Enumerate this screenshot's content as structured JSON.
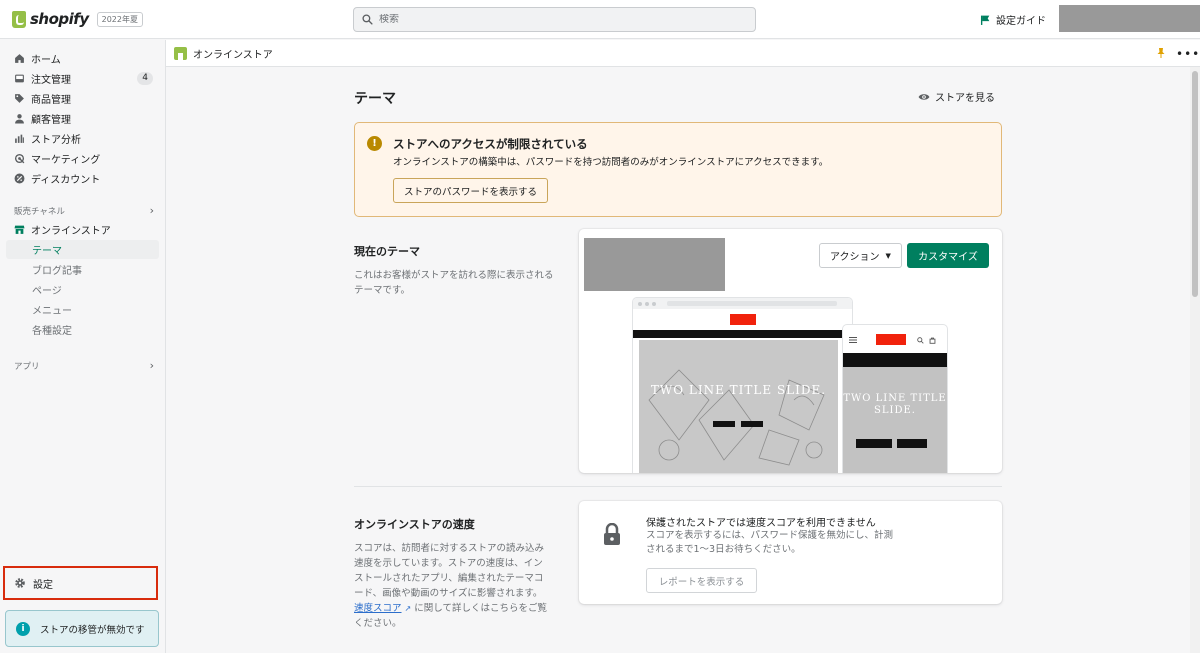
{
  "topbar": {
    "logo_text": "shopify",
    "edition": "2022年夏",
    "search_placeholder": "検索",
    "setup_guide": "設定ガイド"
  },
  "sidebar": {
    "items": [
      {
        "label": "ホーム",
        "icon": "home-icon"
      },
      {
        "label": "注文管理",
        "icon": "orders-icon",
        "badge": "4"
      },
      {
        "label": "商品管理",
        "icon": "tag-icon"
      },
      {
        "label": "顧客管理",
        "icon": "customer-icon"
      },
      {
        "label": "ストア分析",
        "icon": "analytics-icon"
      },
      {
        "label": "マーケティング",
        "icon": "marketing-icon"
      },
      {
        "label": "ディスカウント",
        "icon": "discount-icon"
      }
    ],
    "sales_channels_label": "販売チャネル",
    "online_store_label": "オンラインストア",
    "online_store_subitems": [
      "テーマ",
      "ブログ記事",
      "ページ",
      "メニュー",
      "各種設定"
    ],
    "apps_label": "アプリ",
    "settings_label": "設定",
    "transfer_notice": "ストアの移管が無効です"
  },
  "subheader": {
    "title": "オンラインストア"
  },
  "main": {
    "page_title": "テーマ",
    "view_store": "ストアを見る",
    "warning": {
      "title": "ストアへのアクセスが制限されている",
      "description": "オンラインストアの構築中は、パスワードを持つ訪問者のみがオンラインストアにアクセスできます。",
      "button": "ストアのパスワードを表示する"
    },
    "current_theme": {
      "heading": "現在のテーマ",
      "description": "これはお客様がストアを訪れる際に表示されるテーマです。",
      "action_button": "アクション",
      "customize_button": "カスタマイズ",
      "preview_desktop_title": "TWO LINE TITLE SLIDE.",
      "preview_mobile_title": "TWO LINE TITLE SLIDE."
    },
    "speed": {
      "heading": "オンラインストアの速度",
      "description_pre": "スコアは、訪問者に対するストアの読み込み速度を示しています。ストアの速度は、インストールされたアプリ、編集されたテーマコード、画像や動画のサイズに影響されます。",
      "link": "速度スコア",
      "description_post": "に関して詳しくはこちらをご覧ください。",
      "card_title": "保護されたストアでは速度スコアを利用できません",
      "card_desc": "スコアを表示するには、パスワード保護を無効にし、計測されるまで1〜3日お待ちください。",
      "report_button": "レポートを表示する"
    }
  },
  "colors": {
    "accent_green": "#007f5f",
    "warning_bg": "#fff5ea",
    "warning_border": "#e1b878",
    "highlight_red": "#d82c0d",
    "info_teal": "#00a0ac"
  }
}
